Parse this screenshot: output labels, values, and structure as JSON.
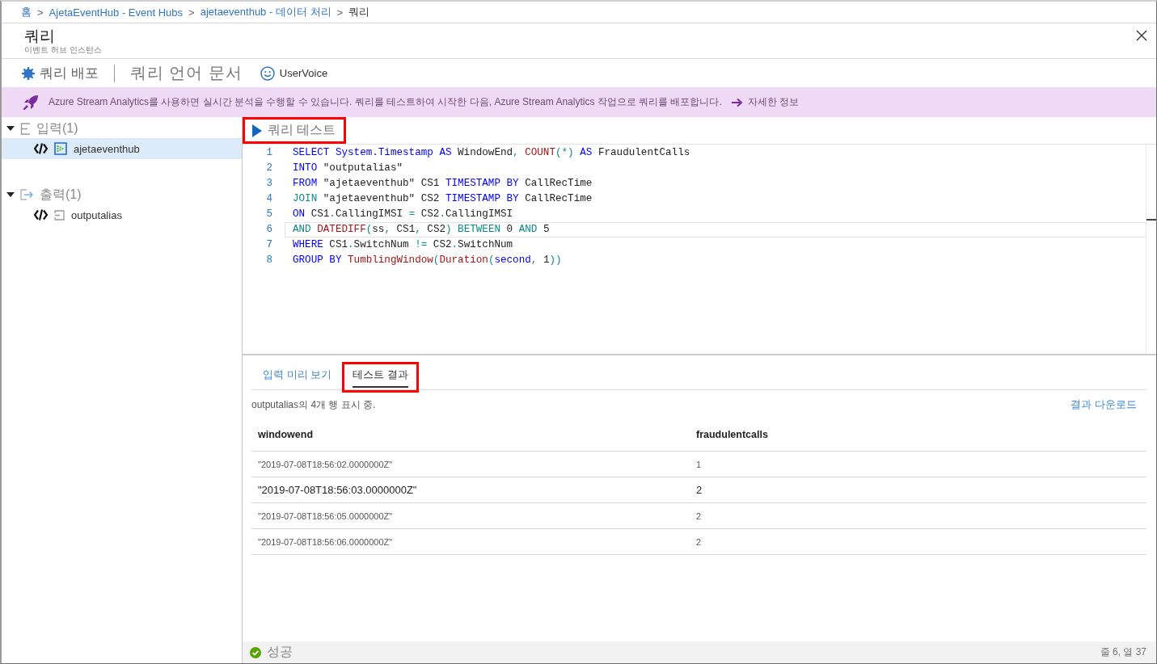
{
  "breadcrumb": [
    {
      "label": "홈",
      "separator": ">",
      "current": false
    },
    {
      "label": "AjetaEventHub - Event Hubs",
      "separator": ">",
      "current": false
    },
    {
      "label": "ajetaeventhub - 데이터 처리",
      "separator": ">",
      "current": false
    },
    {
      "label": "쿼리",
      "current": true
    }
  ],
  "blade": {
    "title": "쿼리",
    "subtitle": "이벤트 허브 인스턴스"
  },
  "toolbar": [
    {
      "kind": "deploy",
      "label": "쿼리 배포"
    },
    {
      "kind": "docs",
      "label": "쿼리 언어 문서"
    },
    {
      "kind": "feedback",
      "label": "UserVoice"
    }
  ],
  "banner": {
    "text": "Azure Stream Analytics를 사용하면 실시간 분석을 수행할 수 있습니다. 쿼리를 테스트하여 시작한 다음, Azure Stream Analytics 작업으로 쿼리를 배포합니다.",
    "link": "자세한 정보"
  },
  "tree": [
    {
      "label": "입력(1)",
      "kind": "input",
      "expanded": true,
      "children": [
        {
          "label": "ajetaeventhub",
          "selected": true
        }
      ]
    },
    {
      "label": "출력(1)",
      "kind": "output",
      "expanded": true,
      "children": [
        {
          "label": "outputalias",
          "selected": false
        }
      ]
    }
  ],
  "editor": {
    "run_button": {
      "label": "쿼리 테스트",
      "annotated": true
    },
    "lines": [
      {
        "number": "1",
        "current": false,
        "tokens": [
          {
            "text": "SELECT System.Timestamp AS",
            "kind": "keyword"
          },
          {
            "text": " WindowEnd",
            "kind": "plain"
          },
          {
            "text": ",",
            "kind": "operator"
          },
          {
            "text": " COUNT",
            "kind": "function"
          },
          {
            "text": "(*)",
            "kind": "operator"
          },
          {
            "text": " AS",
            "kind": "keyword"
          },
          {
            "text": " FraudulentCalls",
            "kind": "plain"
          }
        ]
      },
      {
        "number": "2",
        "current": false,
        "tokens": [
          {
            "text": "INTO",
            "kind": "keyword"
          },
          {
            "text": " \"outputalias\"",
            "kind": "plain"
          }
        ]
      },
      {
        "number": "3",
        "current": false,
        "tokens": [
          {
            "text": "FROM",
            "kind": "keyword"
          },
          {
            "text": " \"ajetaeventhub\" CS1 ",
            "kind": "plain"
          },
          {
            "text": "TIMESTAMP BY",
            "kind": "keyword"
          },
          {
            "text": " CallRecTime",
            "kind": "plain"
          }
        ]
      },
      {
        "number": "4",
        "current": false,
        "tokens": [
          {
            "text": "JOIN",
            "kind": "operator"
          },
          {
            "text": " \"ajetaeventhub\" CS2 ",
            "kind": "plain"
          },
          {
            "text": "TIMESTAMP BY",
            "kind": "keyword"
          },
          {
            "text": " CallRecTime",
            "kind": "plain"
          }
        ]
      },
      {
        "number": "5",
        "current": false,
        "tokens": [
          {
            "text": "ON",
            "kind": "keyword"
          },
          {
            "text": " CS1",
            "kind": "plain"
          },
          {
            "text": ".",
            "kind": "operator"
          },
          {
            "text": "CallingIMSI ",
            "kind": "plain"
          },
          {
            "text": "=",
            "kind": "operator"
          },
          {
            "text": " CS2",
            "kind": "plain"
          },
          {
            "text": ".",
            "kind": "operator"
          },
          {
            "text": "CallingIMSI",
            "kind": "plain"
          }
        ]
      },
      {
        "number": "6",
        "current": true,
        "tokens": [
          {
            "text": "AND",
            "kind": "operator"
          },
          {
            "text": " DATEDIFF",
            "kind": "function"
          },
          {
            "text": "(",
            "kind": "operator"
          },
          {
            "text": "ss",
            "kind": "plain"
          },
          {
            "text": ",",
            "kind": "operator"
          },
          {
            "text": " CS1",
            "kind": "plain"
          },
          {
            "text": ",",
            "kind": "operator"
          },
          {
            "text": " CS2",
            "kind": "plain"
          },
          {
            "text": ")",
            "kind": "operator"
          },
          {
            "text": " BETWEEN",
            "kind": "operator"
          },
          {
            "text": " 0 ",
            "kind": "plain"
          },
          {
            "text": "AND",
            "kind": "operator"
          },
          {
            "text": " 5",
            "kind": "plain"
          }
        ]
      },
      {
        "number": "7",
        "current": false,
        "tokens": [
          {
            "text": "WHERE",
            "kind": "keyword"
          },
          {
            "text": " CS1",
            "kind": "plain"
          },
          {
            "text": ".",
            "kind": "operator"
          },
          {
            "text": "SwitchNum ",
            "kind": "plain"
          },
          {
            "text": "!=",
            "kind": "operator"
          },
          {
            "text": " CS2",
            "kind": "plain"
          },
          {
            "text": ".",
            "kind": "operator"
          },
          {
            "text": "SwitchNum",
            "kind": "plain"
          }
        ]
      },
      {
        "number": "8",
        "current": false,
        "tokens": [
          {
            "text": "GROUP BY",
            "kind": "keyword"
          },
          {
            "text": " TumblingWindow",
            "kind": "function"
          },
          {
            "text": "(",
            "kind": "operator"
          },
          {
            "text": "Duration",
            "kind": "function"
          },
          {
            "text": "(",
            "kind": "operator"
          },
          {
            "text": "second",
            "kind": "keyword"
          },
          {
            "text": ",",
            "kind": "operator"
          },
          {
            "text": " 1",
            "kind": "plain"
          },
          {
            "text": "))",
            "kind": "operator"
          }
        ]
      }
    ]
  },
  "results": {
    "tabs": [
      {
        "label": "입력 미리 보기",
        "selected": false,
        "annotated": false
      },
      {
        "label": "테스트 결과",
        "selected": true,
        "annotated": true
      }
    ],
    "summary": "outputalias의 4개 행 표시 중.",
    "download": "결과 다운로드",
    "table": {
      "columns": [
        "windowend",
        "fraudulentcalls"
      ],
      "rows": [
        {
          "cells": [
            "\"2019-07-08T18:56:02.0000000Z\"",
            "1"
          ],
          "highlighted": false
        },
        {
          "cells": [
            "\"2019-07-08T18:56:03.0000000Z\"",
            "2"
          ],
          "highlighted": true
        },
        {
          "cells": [
            "\"2019-07-08T18:56:05.0000000Z\"",
            "2"
          ],
          "highlighted": false
        },
        {
          "cells": [
            "\"2019-07-08T18:56:06.0000000Z\"",
            "2"
          ],
          "highlighted": false
        }
      ]
    }
  },
  "status_bar": {
    "status": {
      "kind": "success",
      "label": "성공"
    },
    "position": "줄 6, 열 37"
  }
}
